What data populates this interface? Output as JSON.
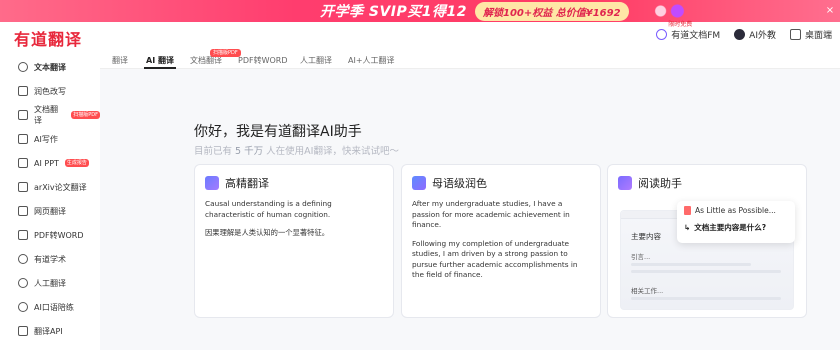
{
  "banner": {
    "title": "开学季 SVIP买1得12",
    "pill": "解锁100+权益 总价值¥1692",
    "close": "×"
  },
  "header": {
    "logo": "有道翻译",
    "right": [
      {
        "label": "有道文档FM",
        "badge": "限时免费"
      },
      {
        "label": "AI外教",
        "badge": ""
      },
      {
        "label": "桌面端",
        "badge": ""
      }
    ]
  },
  "sidebar": {
    "items": [
      {
        "label": "文本翻译",
        "tag": ""
      },
      {
        "label": "润色改写",
        "tag": ""
      },
      {
        "label": "文档翻译",
        "tag": "扫描版PDF"
      },
      {
        "label": "AI写作",
        "tag": ""
      },
      {
        "label": "AI PPT",
        "tag": "生成报告"
      },
      {
        "label": "arXiv论文翻译",
        "tag": ""
      },
      {
        "label": "网页翻译",
        "tag": ""
      },
      {
        "label": "PDF转WORD",
        "tag": ""
      },
      {
        "label": "有道学术",
        "tag": ""
      },
      {
        "label": "人工翻译",
        "tag": ""
      },
      {
        "label": "AI口语陪练",
        "tag": ""
      },
      {
        "label": "翻译API",
        "tag": ""
      }
    ]
  },
  "tabs": {
    "items": [
      "翻译",
      "AI 翻译",
      "文档翻译",
      "PDF转WORD",
      "人工翻译",
      "AI+人工翻译"
    ],
    "badge": "扫描版PDF"
  },
  "main": {
    "greeting": "你好，我是有道翻译AI助手",
    "subtitle_prefix": "目前已有",
    "subtitle_num": "5 千万",
    "subtitle_suffix": "人在使用AI翻译，快来试试吧～",
    "cards": [
      {
        "title": "高精翻译",
        "paragraphs": [
          "Causal understanding is a defining characteristic of human cognition.",
          "因果理解是人类认知的一个显著特征。"
        ]
      },
      {
        "title": "母语级润色",
        "paragraphs": [
          "After my undergraduate studies, I have a passion for more academic achievement in finance.",
          "Following my completion of undergraduate studies, I am driven by a strong passion to pursue further academic accomplishments in the field of finance."
        ]
      },
      {
        "title": "阅读助手",
        "preview": {
          "doc_heading": "主要内容",
          "doc_line1": "引言...",
          "doc_line2": "相关工作...",
          "popup_file": "As Little as Possible...",
          "popup_question": "文档主要内容是什么?"
        }
      }
    ]
  },
  "colors": {
    "brand": "#e8283c",
    "banner": "#ff3d6e"
  }
}
